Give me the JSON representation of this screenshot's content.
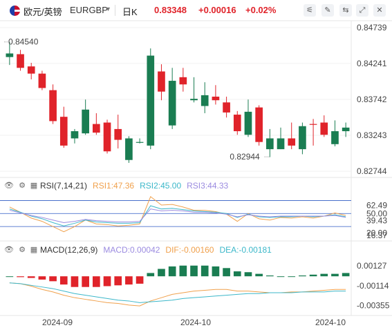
{
  "header": {
    "pair_name": "欧元/英镑",
    "pair_code": "EURGBP",
    "period": "日K",
    "price": "0.83348",
    "change": "+0.00016",
    "change_pct": "+0.02%",
    "tools": [
      "settings-icon",
      "draw-icon",
      "compare-icon",
      "expand-icon",
      "close-icon"
    ]
  },
  "colors": {
    "up": "#1a7d52",
    "down": "#e0232a",
    "rsi1": "#f0a04b",
    "rsi2": "#3bb7c9",
    "rsi3": "#9b8be0",
    "macd": "#3bb7c9",
    "dif": "#f0a04b",
    "dea": "#3bb7c9"
  },
  "chart_data": [
    {
      "type": "candlestick",
      "title": "",
      "y_ticks": [
        "0.84739",
        "0.84241",
        "0.83742",
        "0.83243",
        "0.82744"
      ],
      "ylim": [
        0.82744,
        0.84739
      ],
      "x_ticks": [
        "2024-09",
        "2024-10",
        "2024-10"
      ],
      "annotations": {
        "high": "0.84540",
        "low": "0.82944"
      },
      "candles": [
        {
          "o": 0.8433,
          "c": 0.8438,
          "h": 0.8454,
          "l": 0.8422,
          "d": "up"
        },
        {
          "o": 0.8437,
          "c": 0.8418,
          "h": 0.8443,
          "l": 0.8414,
          "d": "down"
        },
        {
          "o": 0.842,
          "c": 0.841,
          "h": 0.8425,
          "l": 0.8402,
          "d": "down"
        },
        {
          "o": 0.841,
          "c": 0.839,
          "h": 0.8414,
          "l": 0.8387,
          "d": "down"
        },
        {
          "o": 0.8387,
          "c": 0.8344,
          "h": 0.8395,
          "l": 0.834,
          "d": "down"
        },
        {
          "o": 0.835,
          "c": 0.831,
          "h": 0.8364,
          "l": 0.8307,
          "d": "down"
        },
        {
          "o": 0.832,
          "c": 0.833,
          "h": 0.8333,
          "l": 0.8313,
          "d": "up"
        },
        {
          "o": 0.8327,
          "c": 0.836,
          "h": 0.8374,
          "l": 0.8325,
          "d": "up"
        },
        {
          "o": 0.834,
          "c": 0.8328,
          "h": 0.8355,
          "l": 0.8325,
          "d": "down"
        },
        {
          "o": 0.8342,
          "c": 0.8302,
          "h": 0.8346,
          "l": 0.8299,
          "d": "down"
        },
        {
          "o": 0.8333,
          "c": 0.8318,
          "h": 0.8353,
          "l": 0.8306,
          "d": "down"
        },
        {
          "o": 0.832,
          "c": 0.829,
          "h": 0.8323,
          "l": 0.8286,
          "d": "up"
        },
        {
          "o": 0.8315,
          "c": 0.8315,
          "h": 0.832,
          "l": 0.8313,
          "d": "up"
        },
        {
          "o": 0.831,
          "c": 0.8435,
          "h": 0.8445,
          "l": 0.8305,
          "d": "up"
        },
        {
          "o": 0.8413,
          "c": 0.8385,
          "h": 0.8423,
          "l": 0.8373,
          "d": "down"
        },
        {
          "o": 0.8338,
          "c": 0.84,
          "h": 0.8418,
          "l": 0.8333,
          "d": "up"
        },
        {
          "o": 0.8405,
          "c": 0.8395,
          "h": 0.8418,
          "l": 0.8385,
          "d": "down"
        },
        {
          "o": 0.8373,
          "c": 0.8375,
          "h": 0.8405,
          "l": 0.837,
          "d": "up"
        },
        {
          "o": 0.838,
          "c": 0.8365,
          "h": 0.8398,
          "l": 0.8355,
          "d": "up"
        },
        {
          "o": 0.8378,
          "c": 0.8373,
          "h": 0.8394,
          "l": 0.8367,
          "d": "down"
        },
        {
          "o": 0.837,
          "c": 0.8356,
          "h": 0.8378,
          "l": 0.8349,
          "d": "down"
        },
        {
          "o": 0.8353,
          "c": 0.833,
          "h": 0.8358,
          "l": 0.8325,
          "d": "down"
        },
        {
          "o": 0.8325,
          "c": 0.8357,
          "h": 0.8374,
          "l": 0.8322,
          "d": "up"
        },
        {
          "o": 0.8363,
          "c": 0.8315,
          "h": 0.8366,
          "l": 0.831,
          "d": "down"
        },
        {
          "o": 0.832,
          "c": 0.8305,
          "h": 0.8333,
          "l": 0.8294,
          "d": "up"
        },
        {
          "o": 0.8305,
          "c": 0.832,
          "h": 0.8335,
          "l": 0.8305,
          "d": "up"
        },
        {
          "o": 0.832,
          "c": 0.831,
          "h": 0.8342,
          "l": 0.8305,
          "d": "down"
        },
        {
          "o": 0.8305,
          "c": 0.8337,
          "h": 0.8342,
          "l": 0.8298,
          "d": "up"
        },
        {
          "o": 0.834,
          "c": 0.834,
          "h": 0.8347,
          "l": 0.831,
          "d": "down"
        },
        {
          "o": 0.8342,
          "c": 0.8325,
          "h": 0.8352,
          "l": 0.8322,
          "d": "down"
        },
        {
          "o": 0.8312,
          "c": 0.833,
          "h": 0.8345,
          "l": 0.8309,
          "d": "up"
        },
        {
          "o": 0.833,
          "c": 0.8335,
          "h": 0.8342,
          "l": 0.8322,
          "d": "up"
        }
      ]
    },
    {
      "type": "line",
      "title": "RSI(7,14,21)",
      "legend": [
        "RSI1:47.36",
        "RSI2:45.00",
        "RSI3:44.33"
      ],
      "y_ticks": [
        "62.49",
        "50.00",
        "39.43",
        "20.00",
        "16.37"
      ],
      "ylim": [
        10,
        80
      ],
      "reference_lines": [
        70,
        50,
        30
      ],
      "series": [
        {
          "name": "RSI1",
          "values": [
            60,
            52,
            43,
            38,
            30,
            22,
            30,
            40,
            34,
            33,
            31,
            32,
            34,
            76,
            63,
            64,
            60,
            55,
            55,
            53,
            49,
            38,
            50,
            42,
            40,
            44,
            43,
            45,
            43,
            46,
            51,
            47
          ]
        },
        {
          "name": "RSI2",
          "values": [
            57,
            52,
            46,
            42,
            36,
            31,
            35,
            40,
            37,
            36,
            35,
            35,
            36,
            62,
            57,
            58,
            56,
            54,
            53,
            52,
            50,
            44,
            49,
            45,
            44,
            45,
            45,
            46,
            45,
            46,
            48,
            45
          ]
        },
        {
          "name": "RSI3",
          "values": [
            55,
            51,
            47,
            44,
            40,
            36,
            38,
            41,
            39,
            38,
            37,
            37,
            38,
            57,
            54,
            55,
            54,
            52,
            52,
            51,
            49,
            45,
            48,
            46,
            45,
            46,
            46,
            46,
            46,
            46,
            47,
            44
          ]
        }
      ]
    },
    {
      "type": "bar",
      "title": "MACD(12,26,9)",
      "legend": [
        "MACD:0.00042",
        "DIF:-0.00160",
        "DEA:-0.00181"
      ],
      "y_ticks": [
        "0.00127",
        "-0.00114",
        "-0.00355"
      ],
      "ylim": [
        -0.0046,
        0.0022
      ],
      "series": [
        {
          "name": "MACD",
          "values": [
            0.0,
            -0.0001,
            -0.0002,
            -0.0004,
            -0.0006,
            -0.001,
            -0.0013,
            -0.0013,
            -0.0013,
            -0.0012,
            -0.0011,
            -0.001,
            -0.0009,
            0.0004,
            0.0009,
            0.0012,
            0.0013,
            0.0013,
            0.0013,
            0.0012,
            0.001,
            0.0006,
            0.0005,
            0.0003,
            0.0001,
            0.0,
            0.0,
            0.0001,
            0.0002,
            0.0003,
            0.0003,
            0.0004
          ]
        },
        {
          "name": "DIF",
          "values": [
            -0.0008,
            -0.0009,
            -0.0012,
            -0.0016,
            -0.0019,
            -0.0023,
            -0.0026,
            -0.0028,
            -0.003,
            -0.0032,
            -0.0033,
            -0.0035,
            -0.0036,
            -0.003,
            -0.0026,
            -0.0022,
            -0.002,
            -0.0018,
            -0.0017,
            -0.0016,
            -0.0016,
            -0.0018,
            -0.0018,
            -0.0019,
            -0.002,
            -0.002,
            -0.0019,
            -0.0019,
            -0.0018,
            -0.0017,
            -0.0016,
            -0.0016
          ]
        },
        {
          "name": "DEA",
          "values": [
            -0.0008,
            -0.0009,
            -0.0011,
            -0.0013,
            -0.0015,
            -0.0018,
            -0.0021,
            -0.0023,
            -0.0025,
            -0.0027,
            -0.0029,
            -0.003,
            -0.0032,
            -0.0031,
            -0.003,
            -0.0029,
            -0.0027,
            -0.0026,
            -0.0025,
            -0.0024,
            -0.0023,
            -0.0022,
            -0.0021,
            -0.0021,
            -0.002,
            -0.002,
            -0.002,
            -0.0019,
            -0.0019,
            -0.0019,
            -0.0018,
            -0.0018
          ]
        }
      ]
    }
  ]
}
